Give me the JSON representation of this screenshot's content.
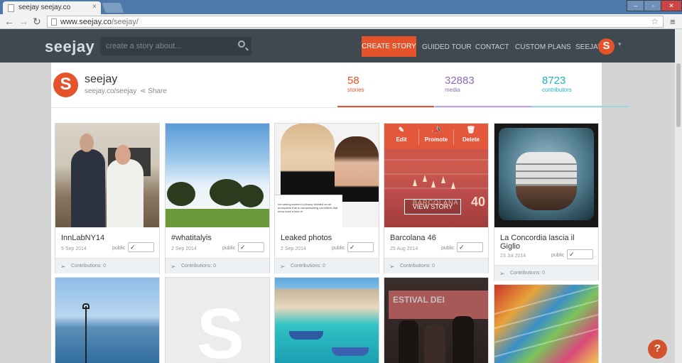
{
  "browser": {
    "tab_title": "seejay seejay.co",
    "tab_close": "×",
    "url_host": "www.seejay.co",
    "url_path": "/seejay/",
    "back_glyph": "←",
    "forward_glyph": "→",
    "reload_glyph": "↻",
    "star_glyph": "☆",
    "menu_glyph": "≡",
    "win_min": "–",
    "win_max": "▫",
    "win_close": "✕"
  },
  "nav": {
    "logo": "seejay",
    "search_placeholder": "create a story about...",
    "create_story": "CREATE STORY",
    "links": [
      "GUIDED TOUR",
      "CONTACT",
      "CUSTOM PLANS"
    ],
    "user": "SEEJAY",
    "avatar_letter": "S",
    "caret": "▾",
    "accent": "#e4532a"
  },
  "profile": {
    "avatar_letter": "S",
    "name": "seejay",
    "url": "seejay.co/seejay",
    "share": "Share",
    "share_glyph": "⋖"
  },
  "stats": [
    {
      "value": "58",
      "label": "stories",
      "color": "#e4532a"
    },
    {
      "value": "32883",
      "label": "media",
      "color": "#8b6bbd"
    },
    {
      "value": "8723",
      "label": "contributors",
      "color": "#1fb2c7"
    }
  ],
  "cards": [
    {
      "title": "InnLabNY14",
      "date": "5 Sep 2014",
      "visibility": "public",
      "contributions": "Contributions: 0"
    },
    {
      "title": "#whatitalyis",
      "date": "2 Sep 2014",
      "visibility": "public",
      "contributions": "Contributions: 0"
    },
    {
      "title": "Leaked photos",
      "date": "2 Sep 2014",
      "visibility": "public",
      "contributions": "Contributions: 0"
    },
    {
      "title": "Barcolana 46",
      "date": "25 Aug 2014",
      "visibility": "public",
      "contributions": "Contributions: 0"
    },
    {
      "title": "La Concordia lascia il Giglio",
      "date": "23 Jul 2014",
      "visibility": "public",
      "contributions": "Contributions: 0"
    }
  ],
  "card_actions": {
    "edit": "Edit",
    "promote": "Promote",
    "delete": "Delete",
    "view_story": "VIEW STORY",
    "edit_icon": "✎",
    "promote_icon": "📣",
    "delete_icon": "🗑"
  },
  "toggle_check": "✓",
  "plane_glyph": "➢",
  "placeholder_letter": "S",
  "image_text": {
    "leaked_tweet": "ren seeing women's privacy violated on an ecosystem that is compensating comments that show such a lack of",
    "barcolana_sign": "BARCOLANA",
    "barcolana_number": "40",
    "festival_banner": "ESTIVAL DEI"
  },
  "help": "?"
}
